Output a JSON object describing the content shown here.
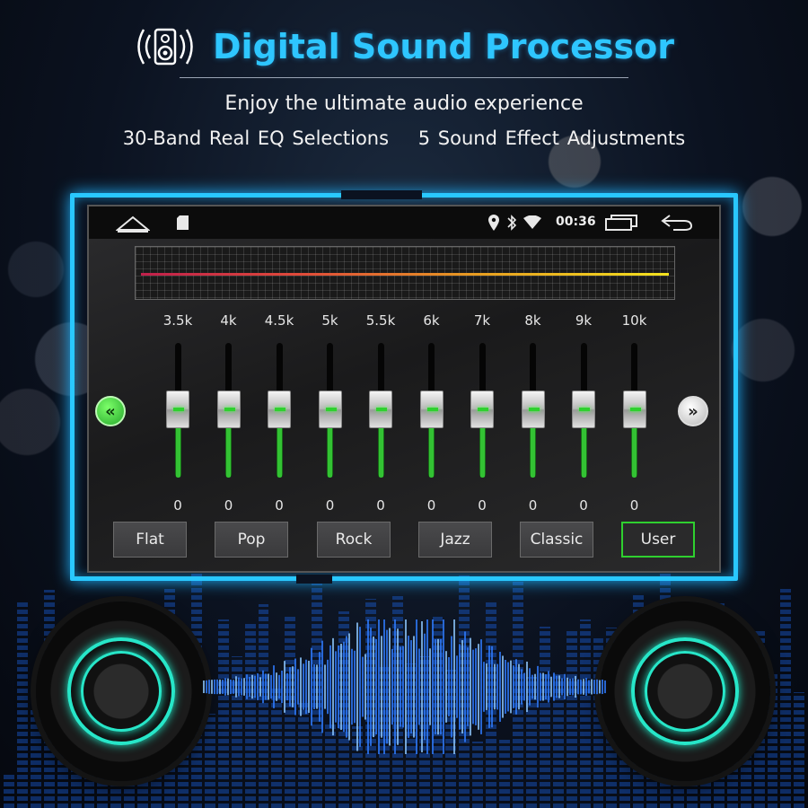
{
  "header": {
    "title": "Digital Sound Processor",
    "subtitle": "Enjoy the ultimate audio experience",
    "feature_left": "30-Band Real EQ Selections",
    "feature_right": "5 Sound Effect Adjustments"
  },
  "statusbar": {
    "time": "00:36",
    "icons": [
      "home-icon",
      "sd-card-icon",
      "location-icon",
      "bluetooth-icon",
      "wifi-icon",
      "window-icon",
      "back-icon"
    ]
  },
  "equalizer": {
    "bands": [
      {
        "freq": "3.5k",
        "value": "0"
      },
      {
        "freq": "4k",
        "value": "0"
      },
      {
        "freq": "4.5k",
        "value": "0"
      },
      {
        "freq": "5k",
        "value": "0"
      },
      {
        "freq": "5.5k",
        "value": "0"
      },
      {
        "freq": "6k",
        "value": "0"
      },
      {
        "freq": "7k",
        "value": "0"
      },
      {
        "freq": "8k",
        "value": "0"
      },
      {
        "freq": "9k",
        "value": "0"
      },
      {
        "freq": "10k",
        "value": "0"
      }
    ],
    "prev_page_icon": "double-chevron-left-icon",
    "next_page_icon": "double-chevron-right-icon"
  },
  "presets": [
    {
      "label": "Flat",
      "active": false
    },
    {
      "label": "Pop",
      "active": false
    },
    {
      "label": "Rock",
      "active": false
    },
    {
      "label": "Jazz",
      "active": false
    },
    {
      "label": "Classic",
      "active": false
    },
    {
      "label": "User",
      "active": true
    }
  ],
  "colors": {
    "title": "#2ec6ff",
    "neon_frame": "#29c8ff",
    "slider_active": "#33c233",
    "preset_active_border": "#2fd02f",
    "speaker_ring": "#27e6c8"
  }
}
